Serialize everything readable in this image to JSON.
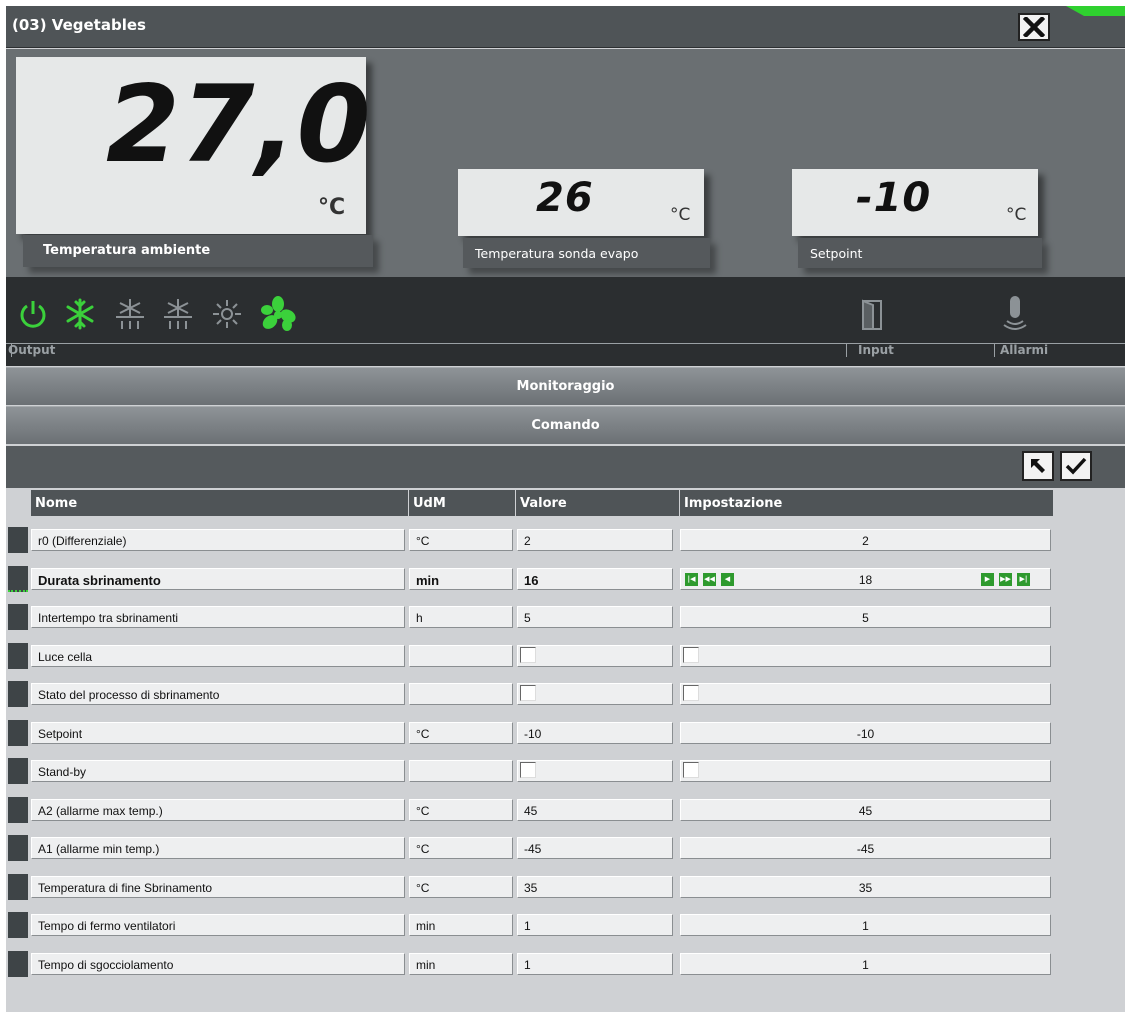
{
  "window": {
    "title": "(03) Vegetables"
  },
  "displays": {
    "main": {
      "value": "27,0",
      "unit": "°C",
      "label": "Temperatura ambiente"
    },
    "evap": {
      "value": "26",
      "unit": "°C",
      "label": "Temperatura sonda evapo"
    },
    "setpoint": {
      "value": "-10",
      "unit": "°C",
      "label": "Setpoint"
    }
  },
  "status": {
    "output_label": "Output",
    "input_label": "Input",
    "alarm_label": "Allarmi",
    "icons": [
      "power-icon",
      "compressor-icon",
      "defrost-icon",
      "defrost-drip-icon",
      "light-icon",
      "fan-icon",
      "door-icon",
      "alarm-icon"
    ],
    "active_color": "#3bd13b",
    "inactive_color": "#8c9296"
  },
  "sections": {
    "monitoring": "Monitoraggio",
    "command": "Comando"
  },
  "table": {
    "headers": {
      "name": "Nome",
      "unit": "UdM",
      "value": "Valore",
      "setting": "Impostazione"
    },
    "rows": [
      {
        "name": "r0 (Differenziale)",
        "unit": "°C",
        "value": "2",
        "setting": "2",
        "type": "num"
      },
      {
        "name": "Durata sbrinamento",
        "unit": "min",
        "value": "16",
        "setting": "18",
        "type": "spin",
        "selected": true
      },
      {
        "name": "Intertempo tra sbrinamenti",
        "unit": "h",
        "value": "5",
        "setting": "5",
        "type": "num"
      },
      {
        "name": "Luce cella",
        "unit": "",
        "value": "",
        "setting": "",
        "type": "bool"
      },
      {
        "name": "Stato del processo di sbrinamento",
        "unit": "",
        "value": "",
        "setting": "",
        "type": "bool"
      },
      {
        "name": "Setpoint",
        "unit": "°C",
        "value": "-10",
        "setting": "-10",
        "type": "num"
      },
      {
        "name": "Stand-by",
        "unit": "",
        "value": "",
        "setting": "",
        "type": "bool"
      },
      {
        "name": "A2 (allarme max temp.)",
        "unit": "°C",
        "value": "45",
        "setting": "45",
        "type": "num"
      },
      {
        "name": "A1 (allarme min temp.)",
        "unit": "°C",
        "value": "-45",
        "setting": "-45",
        "type": "num"
      },
      {
        "name": "Temperatura di fine Sbrinamento",
        "unit": "°C",
        "value": "35",
        "setting": "35",
        "type": "num"
      },
      {
        "name": "Tempo di fermo ventilatori",
        "unit": "min",
        "value": "1",
        "setting": "1",
        "type": "num"
      },
      {
        "name": "Tempo di sgocciolamento",
        "unit": "min",
        "value": "1",
        "setting": "1",
        "type": "num"
      }
    ]
  }
}
